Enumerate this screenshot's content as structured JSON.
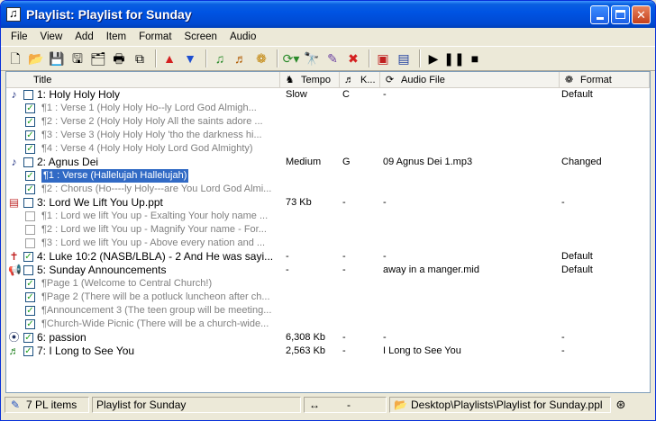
{
  "window": {
    "title": "Playlist: Playlist for Sunday"
  },
  "menu": [
    "File",
    "View",
    "Add",
    "Item",
    "Format",
    "Screen",
    "Audio"
  ],
  "toolbar": [
    {
      "name": "new-playlist-icon",
      "glyph": "🗋"
    },
    {
      "name": "open-folder-icon",
      "glyph": "📂"
    },
    {
      "name": "save-icon",
      "glyph": "💾"
    },
    {
      "name": "save-as-icon",
      "glyph": "🖫"
    },
    {
      "name": "properties-icon",
      "glyph": "🗂"
    },
    {
      "name": "print-icon",
      "glyph": "🖶"
    },
    {
      "name": "copy-icon",
      "glyph": "⧉"
    },
    {
      "name": "sep"
    },
    {
      "name": "move-up-icon",
      "glyph": "▲",
      "color": "#d42020"
    },
    {
      "name": "move-down-icon",
      "glyph": "▼",
      "color": "#1e4fd0"
    },
    {
      "name": "sep"
    },
    {
      "name": "add-song-icon",
      "glyph": "♫",
      "color": "#2a8a2a"
    },
    {
      "name": "add-item-icon",
      "glyph": "♬",
      "color": "#b05a00"
    },
    {
      "name": "theme-icon",
      "glyph": "❁",
      "color": "#c08000"
    },
    {
      "name": "sep"
    },
    {
      "name": "audio-options-icon",
      "glyph": "⟳▾",
      "color": "#2a8a2a"
    },
    {
      "name": "find-icon",
      "glyph": "🔭"
    },
    {
      "name": "edit-icon",
      "glyph": "✎",
      "color": "#6a3fa0"
    },
    {
      "name": "delete-icon",
      "glyph": "✖",
      "color": "#d42020"
    },
    {
      "name": "sep"
    },
    {
      "name": "display-screen-icon",
      "glyph": "▣",
      "color": "#c02020"
    },
    {
      "name": "preview-screen-icon",
      "glyph": "▤",
      "color": "#2040a0"
    },
    {
      "name": "sep"
    },
    {
      "name": "play-icon",
      "glyph": "▶"
    },
    {
      "name": "pause-icon",
      "glyph": "❚❚"
    },
    {
      "name": "stop-icon",
      "glyph": "■"
    }
  ],
  "columns": [
    {
      "key": "title",
      "label": "Title",
      "icon": "sort-icon",
      "glyph": ""
    },
    {
      "key": "tempo",
      "label": "Tempo",
      "icon": "tempo-icon",
      "glyph": "♞"
    },
    {
      "key": "key",
      "label": "K...",
      "icon": "key-icon",
      "glyph": "♬"
    },
    {
      "key": "audio",
      "label": "Audio File",
      "icon": "audio-file-icon",
      "glyph": "⟳"
    },
    {
      "key": "format",
      "label": "Format",
      "icon": "format-icon",
      "glyph": "❁"
    }
  ],
  "rows": [
    {
      "type": "item",
      "icon": "song-icon",
      "glyph": "♪",
      "checked": false,
      "title": "1: Holy Holy Holy",
      "tempo": "Slow",
      "key": "C",
      "audio": "-",
      "format": "Default"
    },
    {
      "type": "sub",
      "checked": true,
      "title": "¶1 : Verse 1 (Holy   Holy   Ho--ly   Lord God Almigh..."
    },
    {
      "type": "sub",
      "checked": true,
      "title": "¶2 : Verse 2 (Holy   Holy   Holy All the saints adore ..."
    },
    {
      "type": "sub",
      "checked": true,
      "title": "¶3 : Verse 3 (Holy   Holy   Holy 'tho the darkness hi..."
    },
    {
      "type": "sub",
      "checked": true,
      "title": "¶4 : Verse 4 (Holy   Holy   Holy Lord God Almighty)"
    },
    {
      "type": "item",
      "icon": "song-icon",
      "glyph": "♪",
      "checked": false,
      "title": "2: Agnus Dei",
      "tempo": "Medium",
      "key": "G",
      "audio": "09 Agnus Dei 1.mp3",
      "format": "Changed"
    },
    {
      "type": "sub",
      "checked": true,
      "selected": true,
      "title": "¶1 : Verse (Hallelujah  Hallelujah)"
    },
    {
      "type": "sub",
      "checked": true,
      "title": "¶2 : Chorus  (Ho----ly Holy---are You Lord God Almi..."
    },
    {
      "type": "item",
      "icon": "presentation-icon",
      "glyph": "▤",
      "checked": false,
      "title": "3: Lord We Lift You Up.ppt",
      "tempo": "73 Kb",
      "key": "-",
      "audio": "-",
      "format": "-"
    },
    {
      "type": "sub",
      "checked": false,
      "title": "¶1 : Lord we lift You up - Exalting Your holy name ..."
    },
    {
      "type": "sub",
      "checked": false,
      "title": "¶2 : Lord we lift You up - Magnify Your name - For..."
    },
    {
      "type": "sub",
      "checked": false,
      "title": "¶3 : Lord we lift You up - Above every nation and ..."
    },
    {
      "type": "item",
      "icon": "scripture-icon",
      "glyph": "✝",
      "checked": true,
      "title": "4: Luke 10:2 (NASB/LBLA) - 2 And He was sayi...",
      "tempo": "-",
      "key": "-",
      "audio": "-",
      "format": "Default"
    },
    {
      "type": "item",
      "icon": "announcement-icon",
      "glyph": "📢",
      "checked": false,
      "title": "5: Sunday Announcements",
      "tempo": "-",
      "key": "-",
      "audio": "away in a manger.mid",
      "format": "Default"
    },
    {
      "type": "sub",
      "checked": true,
      "title": "¶Page 1 (Welcome to Central Church!)"
    },
    {
      "type": "sub",
      "checked": true,
      "title": "¶Page 2 (There will be a potluck luncheon after ch..."
    },
    {
      "type": "sub",
      "checked": true,
      "title": "¶Announcement 3 (The teen group will be meeting..."
    },
    {
      "type": "sub",
      "checked": true,
      "title": "¶Church-Wide Picnic (There will be a church-wide..."
    },
    {
      "type": "item",
      "icon": "video-icon",
      "glyph": "⦿",
      "checked": true,
      "title": "6: passion",
      "tempo": "6,308 Kb",
      "key": "-",
      "audio": "-",
      "format": "-"
    },
    {
      "type": "item",
      "icon": "audio-clip-icon",
      "glyph": "♬",
      "checked": true,
      "title": "7: I Long to See You",
      "tempo": "2,563 Kb",
      "key": "-",
      "audio": "I Long to See You",
      "format": "-"
    }
  ],
  "status": {
    "items": "7 PL items",
    "playlist": "Playlist for Sunday",
    "position_icon": "↔",
    "position": "-",
    "path": "Desktop\\Playlists\\Playlist for Sunday.ppl"
  }
}
